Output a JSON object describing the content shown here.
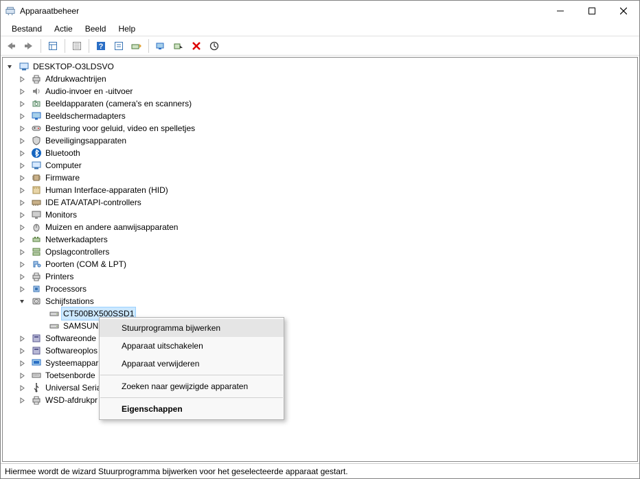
{
  "title": "Apparaatbeheer",
  "menus": {
    "file": "Bestand",
    "action": "Actie",
    "view": "Beeld",
    "help": "Help"
  },
  "root": {
    "name": "DESKTOP-O3LDSVO"
  },
  "categories": [
    {
      "key": "printqueues",
      "label": "Afdrukwachtrijen",
      "expanded": false
    },
    {
      "key": "audio",
      "label": "Audio-invoer en -uitvoer",
      "expanded": false
    },
    {
      "key": "imaging",
      "label": "Beeldapparaten (camera's en scanners)",
      "expanded": false
    },
    {
      "key": "display",
      "label": "Beeldschermadapters",
      "expanded": false
    },
    {
      "key": "sgv",
      "label": "Besturing voor geluid, video en spelletjes",
      "expanded": false
    },
    {
      "key": "security",
      "label": "Beveiligingsapparaten",
      "expanded": false
    },
    {
      "key": "bluetooth",
      "label": "Bluetooth",
      "expanded": false
    },
    {
      "key": "computer",
      "label": "Computer",
      "expanded": false
    },
    {
      "key": "firmware",
      "label": "Firmware",
      "expanded": false
    },
    {
      "key": "hid",
      "label": "Human Interface-apparaten (HID)",
      "expanded": false
    },
    {
      "key": "ide",
      "label": "IDE ATA/ATAPI-controllers",
      "expanded": false
    },
    {
      "key": "monitors",
      "label": "Monitors",
      "expanded": false
    },
    {
      "key": "mice",
      "label": "Muizen en andere aanwijsapparaten",
      "expanded": false
    },
    {
      "key": "net",
      "label": "Netwerkadapters",
      "expanded": false
    },
    {
      "key": "storage",
      "label": "Opslagcontrollers",
      "expanded": false
    },
    {
      "key": "ports",
      "label": "Poorten (COM & LPT)",
      "expanded": false
    },
    {
      "key": "printers",
      "label": "Printers",
      "expanded": false
    },
    {
      "key": "cpu",
      "label": "Processors",
      "expanded": false
    },
    {
      "key": "disks",
      "label": "Schijfstations",
      "expanded": true,
      "children": [
        {
          "key": "d1",
          "label": "CT500BX500SSD1",
          "selected": true
        },
        {
          "key": "d2",
          "label": "SAMSUNG",
          "selected": false
        }
      ]
    },
    {
      "key": "swcomp",
      "label": "Softwareonde",
      "expanded": false
    },
    {
      "key": "swdev",
      "label": "Softwareoplos",
      "expanded": false
    },
    {
      "key": "system",
      "label": "Systeemappar",
      "expanded": false
    },
    {
      "key": "keyboard",
      "label": "Toetsenborde",
      "expanded": false
    },
    {
      "key": "usb",
      "label": "Universal Seria",
      "expanded": false
    },
    {
      "key": "wsd",
      "label": "WSD-afdrukpr",
      "expanded": false
    }
  ],
  "context_menu": {
    "items": [
      {
        "label": "Stuurprogramma bijwerken",
        "highlight": true
      },
      {
        "label": "Apparaat uitschakelen"
      },
      {
        "label": "Apparaat verwijderen"
      },
      {
        "sep": true
      },
      {
        "label": "Zoeken naar gewijzigde apparaten"
      },
      {
        "sep": true
      },
      {
        "label": "Eigenschappen",
        "bold": true
      }
    ]
  },
  "status_text": "Hiermee wordt de wizard Stuurprogramma bijwerken voor het geselecteerde apparaat gestart."
}
